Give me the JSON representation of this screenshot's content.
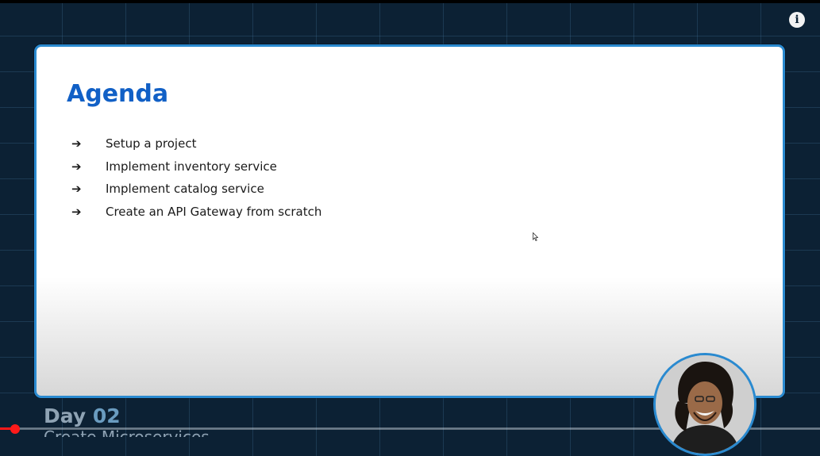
{
  "slide": {
    "title": "Agenda",
    "items": [
      {
        "arrow": "➔",
        "text": "Setup a project"
      },
      {
        "arrow": "➔",
        "text": "Implement inventory service"
      },
      {
        "arrow": "➔",
        "text": "Implement catalog service"
      },
      {
        "arrow": "➔",
        "text": "Create an API Gateway from scratch"
      }
    ]
  },
  "footer": {
    "day_prefix": "Day ",
    "day_number": "02",
    "subtitle": "Create Microservices"
  },
  "player": {
    "info_icon_glyph": "i",
    "progress_fraction": 0.02,
    "accent_color": "#ff1a1a"
  },
  "colors": {
    "background": "#0c2134",
    "slide_border": "#2a8ad0",
    "title": "#1160c6"
  }
}
